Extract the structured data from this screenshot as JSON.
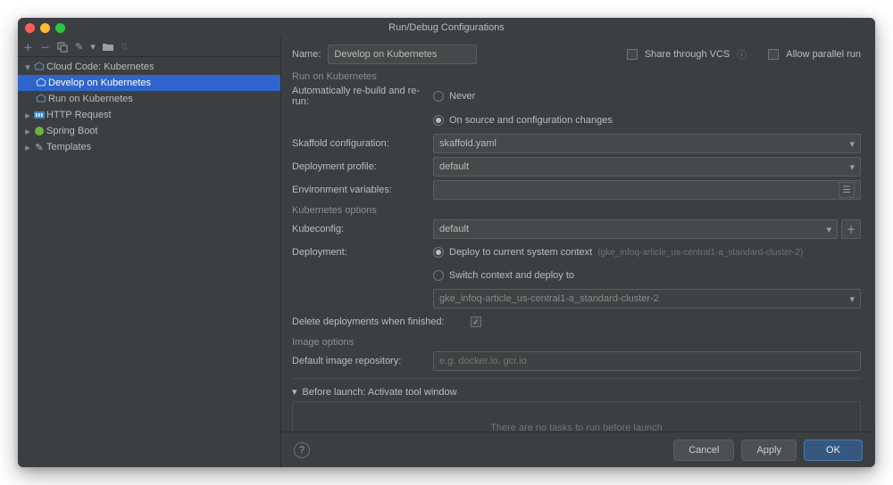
{
  "title": "Run/Debug Configurations",
  "sidebar": {
    "items": [
      {
        "label": "Cloud Code: Kubernetes",
        "expanded": true
      },
      {
        "label": "Develop on Kubernetes",
        "selected": true
      },
      {
        "label": "Run on Kubernetes"
      },
      {
        "label": "HTTP Request"
      },
      {
        "label": "Spring Boot"
      },
      {
        "label": "Templates"
      }
    ]
  },
  "form": {
    "name_label": "Name:",
    "name_value": "Develop on Kubernetes",
    "share_label": "Share through VCS",
    "allow_parallel_label": "Allow parallel run",
    "section_run": "Run on Kubernetes",
    "auto_rebuild_label": "Automatically re-build and re-run:",
    "auto_never": "Never",
    "auto_onchange": "On source and configuration changes",
    "skaffold_label": "Skaffold configuration:",
    "skaffold_value": "skaffold.yaml",
    "profile_label": "Deployment profile:",
    "profile_value": "default",
    "env_label": "Environment variables:",
    "section_k8s": "Kubernetes options",
    "kubeconfig_label": "Kubeconfig:",
    "kubeconfig_value": "default",
    "deployment_label": "Deployment:",
    "deploy_current": "Deploy to current system context",
    "deploy_current_hint": "(gke_infoq-article_us-central1-a_standard-cluster-2)",
    "deploy_switch": "Switch context and deploy to",
    "deploy_switch_value": "gke_infoq-article_us-central1-a_standard-cluster-2",
    "delete_label": "Delete deployments when finished:",
    "section_image": "Image options",
    "repo_label": "Default image repository:",
    "repo_placeholder": "e.g. docker.io, gcr.io",
    "before_launch": "Before launch: Activate tool window",
    "launch_empty": "There are no tasks to run before launch"
  },
  "footer": {
    "cancel": "Cancel",
    "apply": "Apply",
    "ok": "OK"
  }
}
